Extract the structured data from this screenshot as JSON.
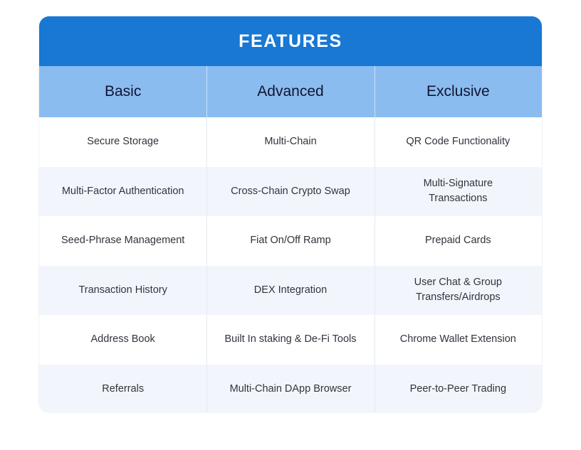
{
  "card": {
    "title": "FEATURES",
    "accent_color": "#1878D4",
    "subheader_color": "#8BBCF0",
    "alt_row_color": "#F2F6FC",
    "title_text_color": "#FFFFFF",
    "header_text_color": "#121530",
    "body_text_color": "#30343C"
  },
  "table": {
    "columns": [
      {
        "label": "Basic"
      },
      {
        "label": "Advanced"
      },
      {
        "label": "Exclusive"
      }
    ],
    "rows": [
      {
        "basic": "Secure Storage",
        "advanced": "Multi-Chain",
        "exclusive": "QR Code Functionality"
      },
      {
        "basic": "Multi-Factor Authentication",
        "advanced": "Cross-Chain Crypto Swap",
        "exclusive": "Multi-Signature\nTransactions"
      },
      {
        "basic": "Seed-Phrase Management",
        "advanced": "Fiat On/Off Ramp",
        "exclusive": "Prepaid Cards"
      },
      {
        "basic": "Transaction History",
        "advanced": "DEX Integration",
        "exclusive": "User Chat & Group\nTransfers/Airdrops"
      },
      {
        "basic": "Address Book",
        "advanced": "Built In staking & De-Fi Tools",
        "exclusive": "Chrome Wallet Extension"
      },
      {
        "basic": "Referrals",
        "advanced": "Multi-Chain DApp Browser",
        "exclusive": "Peer-to-Peer Trading"
      }
    ]
  }
}
